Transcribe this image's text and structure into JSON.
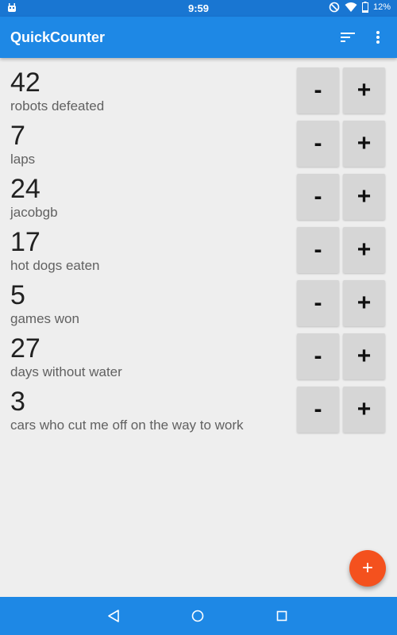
{
  "status_bar": {
    "time": "9:59",
    "battery": "12%",
    "icons": [
      "android-debug-icon",
      "do-not-disturb-icon",
      "wifi-icon",
      "battery-icon"
    ]
  },
  "app_bar": {
    "title": "QuickCounter",
    "actions": [
      "sort-icon",
      "more-vert-icon"
    ]
  },
  "counters": [
    {
      "count": "42",
      "label": "robots defeated"
    },
    {
      "count": "7",
      "label": "laps"
    },
    {
      "count": "24",
      "label": "jacobgb"
    },
    {
      "count": "17",
      "label": "hot dogs eaten"
    },
    {
      "count": "5",
      "label": "games won"
    },
    {
      "count": "27",
      "label": "days without water"
    },
    {
      "count": "3",
      "label": "cars who cut me off on the way to work"
    }
  ],
  "buttons": {
    "decrement": "-",
    "increment": "+",
    "fab": "+"
  },
  "colors": {
    "status_bar": "#1976d2",
    "app_bar": "#1e88e5",
    "fab": "#f4511e",
    "background": "#eeeeee",
    "counter_button": "#d6d6d6"
  },
  "nav_bar": {
    "icons": [
      "back-icon",
      "home-icon",
      "recents-icon"
    ]
  }
}
